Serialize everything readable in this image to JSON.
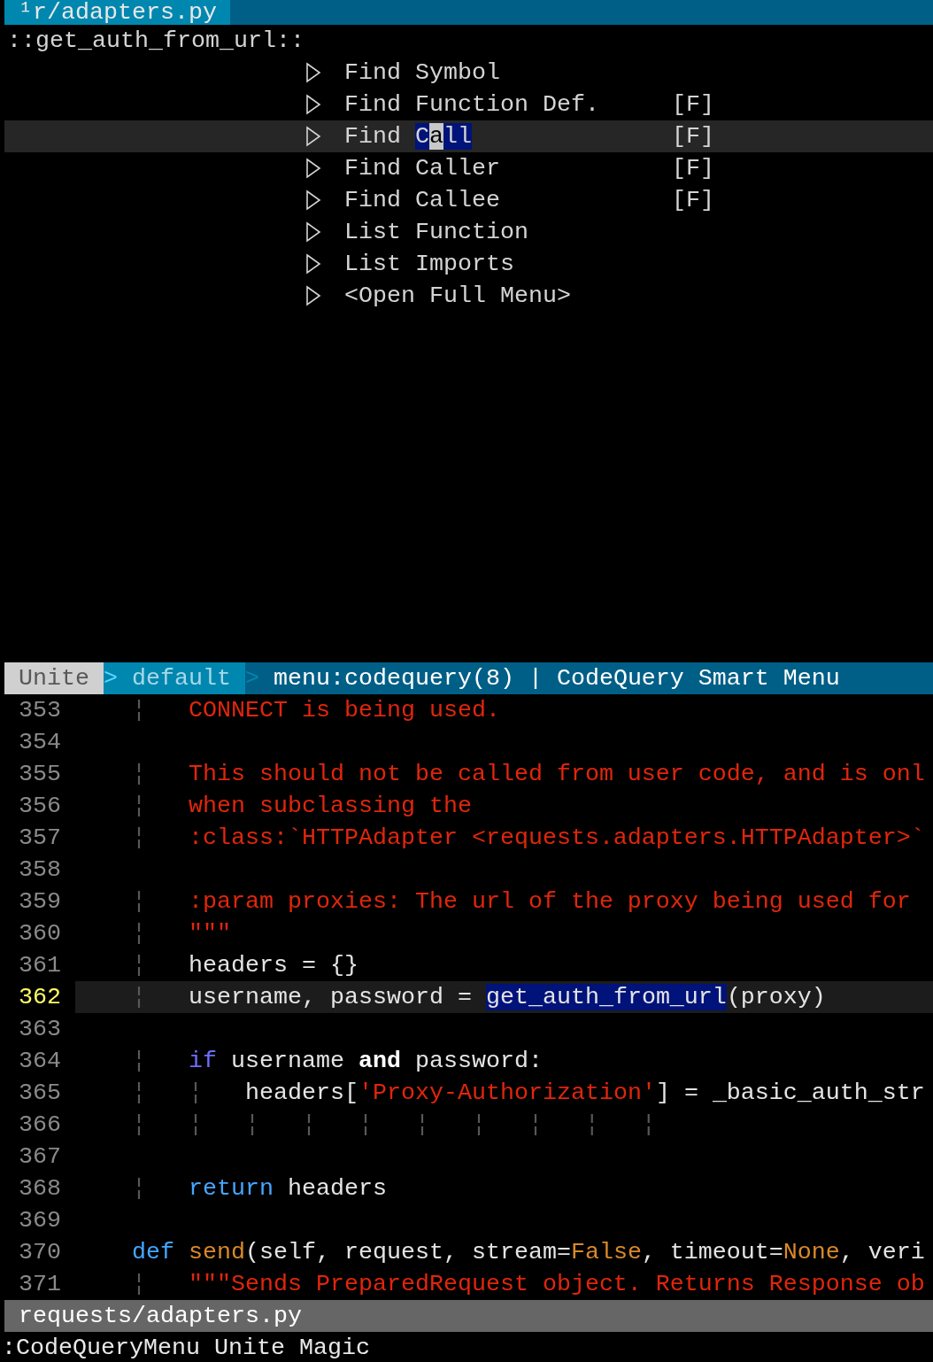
{
  "tab_line": {
    "tab": "¹r/adapters.py"
  },
  "menu_title": "::get_auth_from_url::",
  "menu_items": [
    {
      "selected": false,
      "segments": [
        {
          "text": "Find Symbol"
        }
      ]
    },
    {
      "selected": false,
      "segments": [
        {
          "text": "Find Function Def."
        }
      ],
      "tag": "[F]"
    },
    {
      "selected": true,
      "segments": [
        {
          "text": "Find "
        },
        {
          "text": "C",
          "kind": "match"
        },
        {
          "text": "a",
          "kind": "cursor"
        },
        {
          "text": "ll",
          "kind": "match"
        }
      ],
      "tag": "[F]"
    },
    {
      "selected": false,
      "segments": [
        {
          "text": "Find Caller"
        }
      ],
      "tag": "[F]"
    },
    {
      "selected": false,
      "segments": [
        {
          "text": "Find Callee"
        }
      ],
      "tag": "[F]"
    },
    {
      "selected": false,
      "segments": [
        {
          "text": "List Function"
        }
      ]
    },
    {
      "selected": false,
      "segments": [
        {
          "text": "List Imports"
        }
      ]
    },
    {
      "selected": false,
      "segments": [
        {
          "text": "<Open Full Menu>"
        }
      ]
    }
  ],
  "unite_status": [
    {
      "text": "Unite",
      "kind": "mode"
    },
    {
      "text": ">",
      "kind": "separator_a"
    },
    {
      "text": "default",
      "kind": "buffer"
    },
    {
      "text": ">",
      "kind": "separator_b"
    },
    {
      "text": "menu:codequery(8) | CodeQuery Smart Menu",
      "kind": "info"
    }
  ],
  "code_lines": [
    {
      "number": "353",
      "current": false,
      "segments": [
        {
          "text": "    ¦   ",
          "kind": "guide"
        },
        {
          "text": "CONNECT is being used.",
          "kind": "string"
        }
      ]
    },
    {
      "number": "354",
      "current": false
    },
    {
      "number": "355",
      "current": false,
      "segments": [
        {
          "text": "    ¦   ",
          "kind": "guide"
        },
        {
          "text": "This should not be called from user code, and is onl",
          "kind": "string"
        }
      ]
    },
    {
      "number": "356",
      "current": false,
      "segments": [
        {
          "text": "    ¦   ",
          "kind": "guide"
        },
        {
          "text": "when subclassing the",
          "kind": "string"
        }
      ]
    },
    {
      "number": "357",
      "current": false,
      "segments": [
        {
          "text": "    ¦   ",
          "kind": "guide"
        },
        {
          "text": ":class:`HTTPAdapter <requests.adapters.HTTPAdapter>`",
          "kind": "string"
        }
      ]
    },
    {
      "number": "358",
      "current": false
    },
    {
      "number": "359",
      "current": false,
      "segments": [
        {
          "text": "    ¦   ",
          "kind": "guide"
        },
        {
          "text": ":param proxies: The url of the proxy being used for",
          "kind": "string"
        }
      ]
    },
    {
      "number": "360",
      "current": false,
      "segments": [
        {
          "text": "    ¦   ",
          "kind": "guide"
        },
        {
          "text": "\"\"\"",
          "kind": "string"
        }
      ]
    },
    {
      "number": "361",
      "current": false,
      "segments": [
        {
          "text": "    ¦   ",
          "kind": "guide"
        },
        {
          "text": "headers = {}"
        }
      ]
    },
    {
      "number": "362",
      "current": true,
      "segments": [
        {
          "text": "    ¦   ",
          "kind": "guide"
        },
        {
          "text": "username, password = "
        },
        {
          "text": "get_auth_from_url",
          "kind": "match"
        },
        {
          "text": "(proxy)"
        }
      ]
    },
    {
      "number": "363",
      "current": false
    },
    {
      "number": "364",
      "current": false,
      "segments": [
        {
          "text": "    ¦   ",
          "kind": "guide"
        },
        {
          "text": "if",
          "kind": "conditional"
        },
        {
          "text": " username "
        },
        {
          "text": "and",
          "kind": "operator"
        },
        {
          "text": " password:"
        }
      ]
    },
    {
      "number": "365",
      "current": false,
      "segments": [
        {
          "text": "    ¦   ¦   ",
          "kind": "guide"
        },
        {
          "text": "headers["
        },
        {
          "text": "'Proxy-Authorization'",
          "kind": "string"
        },
        {
          "text": "] = _basic_auth_str"
        }
      ]
    },
    {
      "number": "366",
      "current": false,
      "segments": [
        {
          "text": "    ¦   ¦   ¦   ¦   ¦   ¦   ¦   ¦   ¦   ¦",
          "kind": "guide"
        }
      ]
    },
    {
      "number": "367",
      "current": false
    },
    {
      "number": "368",
      "current": false,
      "segments": [
        {
          "text": "    ¦   ",
          "kind": "guide"
        },
        {
          "text": "return",
          "kind": "statement"
        },
        {
          "text": " headers"
        }
      ]
    },
    {
      "number": "369",
      "current": false
    },
    {
      "number": "370",
      "current": false,
      "segments": [
        {
          "text": "    def",
          "kind": "statement"
        },
        {
          "text": " send",
          "kind": "function"
        },
        {
          "text": "(self, request, stream="
        },
        {
          "text": "False",
          "kind": "constant"
        },
        {
          "text": ", timeout="
        },
        {
          "text": "None",
          "kind": "constant"
        },
        {
          "text": ", veri"
        }
      ]
    },
    {
      "number": "371",
      "current": false,
      "segments": [
        {
          "text": "    ¦   ",
          "kind": "guide"
        },
        {
          "text": "\"\"\"Sends PreparedRequest object. Returns Response ob",
          "kind": "string"
        }
      ]
    }
  ],
  "file_status": "requests/adapters.py",
  "command_line": ":CodeQueryMenu Unite Magic"
}
